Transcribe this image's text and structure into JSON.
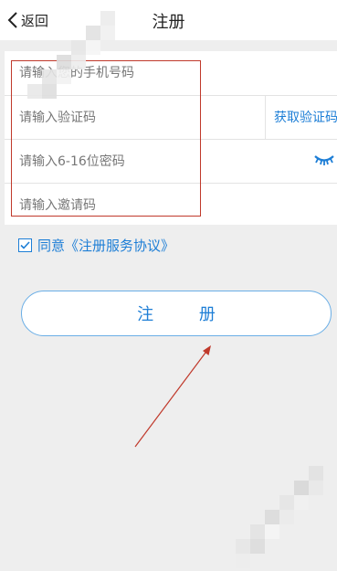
{
  "header": {
    "back_label": "返回",
    "title": "注册"
  },
  "form": {
    "phone_placeholder": "请输入您的手机号码",
    "code_placeholder": "请输入验证码",
    "get_code_label": "获取验证码",
    "password_placeholder": "请输入6-16位密码",
    "invite_placeholder": "请输入邀请码"
  },
  "agreement": {
    "checked": true,
    "label": "同意《注册服务协议》"
  },
  "register_button": "注  册",
  "colors": {
    "accent": "#1d7ed6",
    "annotation": "#c0392b",
    "background": "#eeeeee"
  },
  "icons": [
    "chevron-left-icon",
    "eye-closed-icon",
    "checkmark-icon"
  ]
}
